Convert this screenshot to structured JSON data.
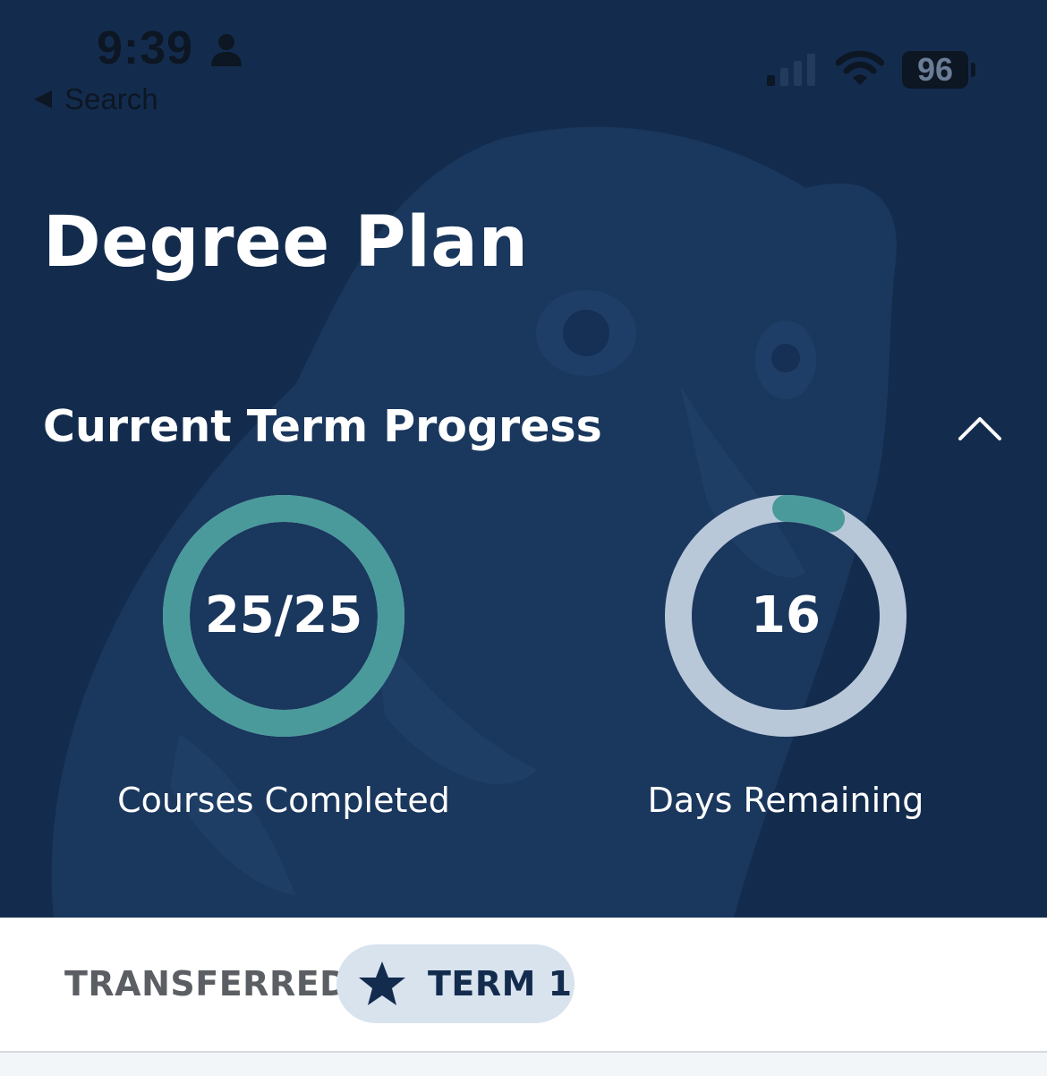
{
  "status_bar": {
    "time": "9:39",
    "back_label": "Search",
    "battery": "96"
  },
  "header": {
    "title": "Degree Plan"
  },
  "progress": {
    "section_title": "Current Term Progress",
    "courses": {
      "value": "25/25",
      "label": "Courses Completed",
      "completed": 25,
      "total": 25
    },
    "days": {
      "value": "16",
      "label": "Days Remaining",
      "fraction": 0.07
    }
  },
  "tabs": [
    {
      "label": "TRANSFERRED",
      "selected": false
    },
    {
      "label": "TERM 1",
      "selected": true,
      "icon": "star-icon"
    }
  ],
  "colors": {
    "hero_background": "#132c4e",
    "ring_progress": "#4a9a9c",
    "ring_track": "#b8c8d9",
    "selected_tab_bg": "#d8e3ee",
    "selected_tab_text": "#132c4e"
  }
}
